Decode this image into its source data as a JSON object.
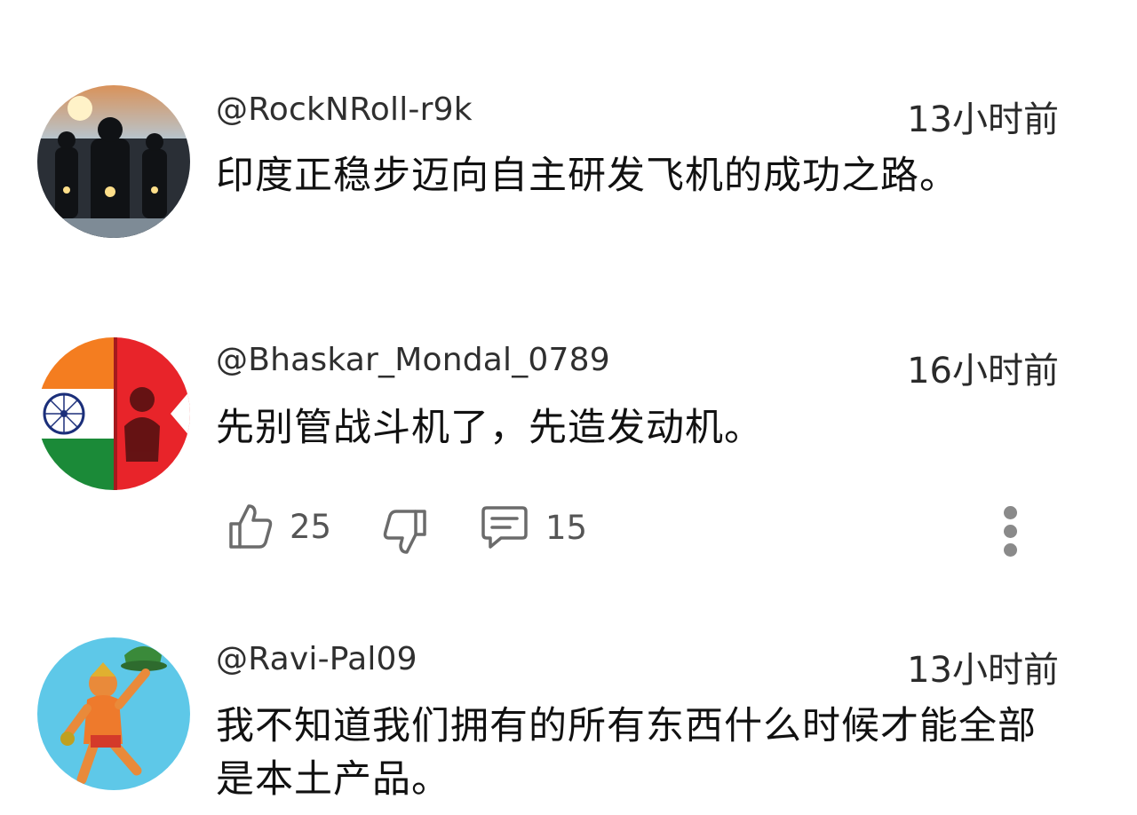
{
  "comments": [
    {
      "username": "@RockNRoll-r9k",
      "time": "13小时前",
      "text": "印度正稳步迈向自主研发飞机的成功之路。",
      "avatar": "motorcycle-riders-avatar"
    },
    {
      "username": "@Bhaskar_Mondal_0789",
      "time": "16小时前",
      "text": "先别管战斗机了，先造发动机。",
      "avatar": "india-flag-avatar",
      "actions": {
        "likes": "25",
        "replies": "15"
      }
    },
    {
      "username": "@Ravi-Pal09",
      "time": "13小时前",
      "text": "我不知道我们拥有的所有东西什么时候才能全部是本土产品。",
      "avatar": "hanuman-avatar"
    }
  ],
  "colors": {
    "text": "#111111",
    "meta": "#2f2f2f",
    "icon": "#6b6b6b",
    "background": "#ffffff"
  }
}
